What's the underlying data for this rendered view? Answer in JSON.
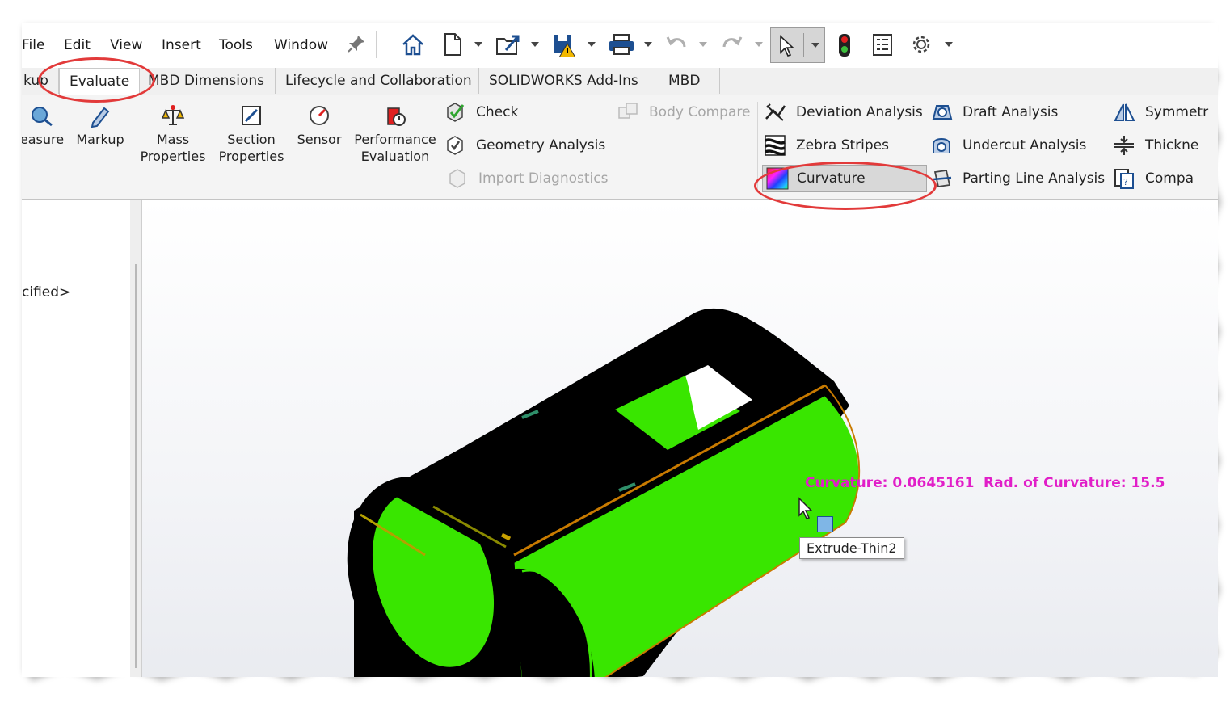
{
  "menubar": {
    "items": [
      "File",
      "Edit",
      "View",
      "Insert",
      "Tools",
      "Window"
    ]
  },
  "tabs": [
    {
      "label": "kup",
      "active": false
    },
    {
      "label": "Evaluate",
      "active": true
    },
    {
      "label": "MBD Dimensions",
      "active": false
    },
    {
      "label": "Lifecycle and Collaboration",
      "active": false
    },
    {
      "label": "SOLIDWORKS Add-Ins",
      "active": false
    },
    {
      "label": "MBD",
      "active": false
    }
  ],
  "ribbon": {
    "big_buttons": [
      {
        "line1": "easure",
        "line2": "",
        "icon": "measure-icon"
      },
      {
        "line1": "Markup",
        "line2": "",
        "icon": "markup-icon"
      },
      {
        "line1": "Mass",
        "line2": "Properties",
        "icon": "mass-properties-icon"
      },
      {
        "line1": "Section",
        "line2": "Properties",
        "icon": "section-properties-icon"
      },
      {
        "line1": "Sensor",
        "line2": "",
        "icon": "sensor-icon"
      },
      {
        "line1": "Performance",
        "line2": "Evaluation",
        "icon": "performance-evaluation-icon"
      }
    ],
    "check": "Check",
    "geometry_analysis": "Geometry Analysis",
    "import_diagnostics": "Import Diagnostics",
    "body_compare": "Body Compare",
    "deviation_analysis": "Deviation Analysis",
    "zebra_stripes": "Zebra Stripes",
    "curvature": "Curvature",
    "draft_analysis": "Draft Analysis",
    "undercut_analysis": "Undercut Analysis",
    "parting_line_analysis": "Parting Line Analysis",
    "symmetry": "Symmetr",
    "thickness": "Thickne",
    "compare": "Compa"
  },
  "feature_tree": {
    "partial_item": "cified>"
  },
  "viewport": {
    "curvature_readout": "Curvature: 0.0645161",
    "radius_readout": "Rad. of Curvature: 15.5",
    "tooltip": "Extrude-Thin2"
  },
  "colors": {
    "annotation_red": "#e23a3a",
    "readout_magenta": "#e11ec8",
    "part_green": "#39e600",
    "part_black": "#000000",
    "edge_orange": "#c87a00"
  }
}
